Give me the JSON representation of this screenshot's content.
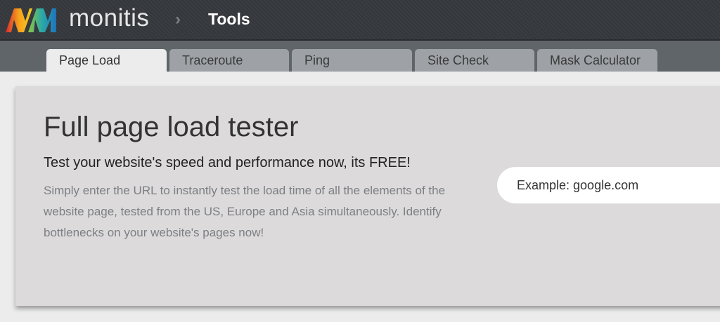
{
  "header": {
    "brand": "monitis",
    "breadcrumb_separator": "›",
    "page": "Tools",
    "logo_icon": "monitis-m-logo"
  },
  "tabs": [
    {
      "label": "Page Load",
      "active": true
    },
    {
      "label": "Traceroute",
      "active": false
    },
    {
      "label": "Ping",
      "active": false
    },
    {
      "label": "Site Check",
      "active": false
    },
    {
      "label": "Mask Calculator",
      "active": false
    }
  ],
  "panel": {
    "title": "Full page load tester",
    "subtitle": "Test your website's speed and performance now, its FREE!",
    "description": "Simply enter the URL to instantly test the load time of all the elements of the website page, tested from the US, Europe and Asia simultaneously. Identify bottlenecks on your website's pages now!",
    "url_input": {
      "value": "",
      "placeholder": "Example: google.com"
    }
  },
  "colors": {
    "header_bg": "#3a3d41",
    "tabbar_bg": "#5f6569",
    "tab_inactive": "#9ea2a6",
    "tab_active": "#ececec",
    "panel_bg": "#dcdada"
  }
}
